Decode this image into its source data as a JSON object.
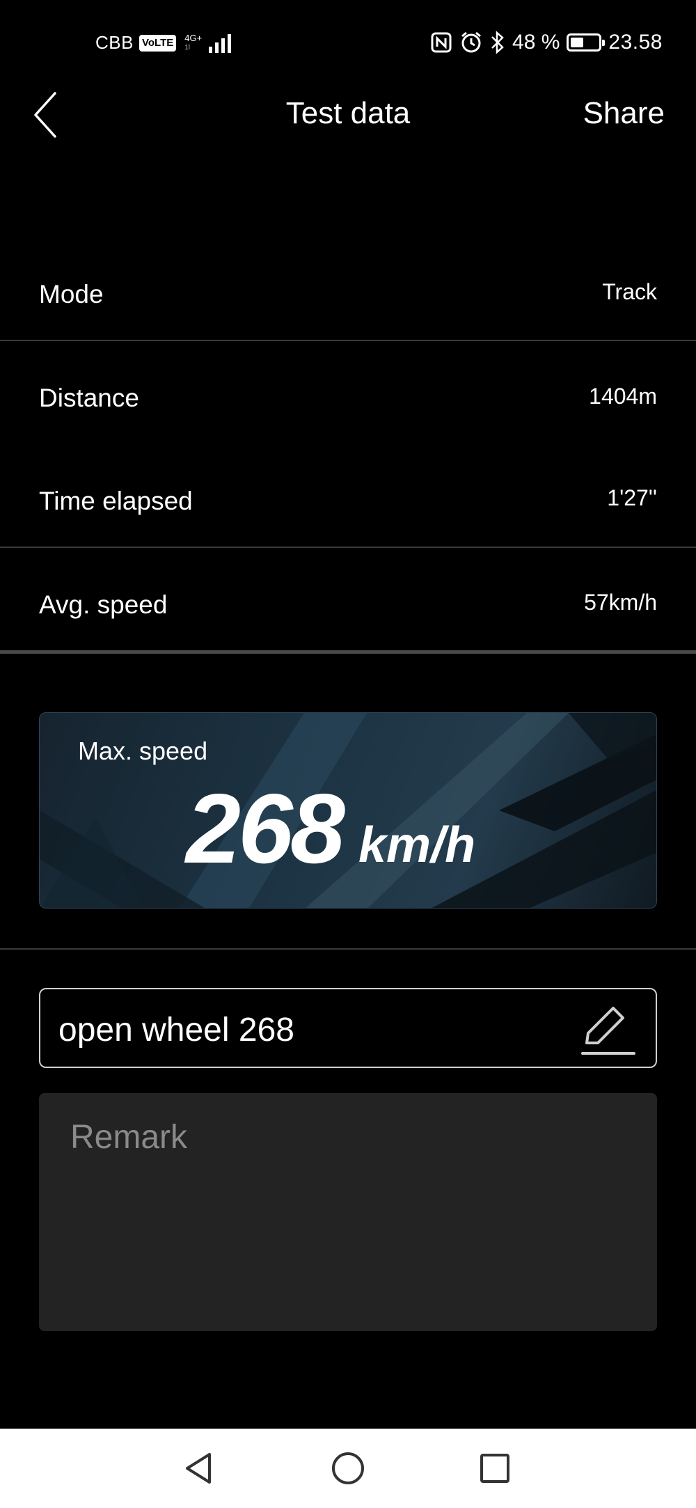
{
  "status_bar": {
    "carrier": "CBB",
    "volte": "VoLTE",
    "network": "4G+",
    "network_sub": "1l",
    "battery_percent": "48 %",
    "battery_level": 0.48,
    "time": "23.58",
    "icons": [
      "nfc-icon",
      "alarm-icon",
      "bluetooth-icon",
      "battery-icon"
    ]
  },
  "header": {
    "title": "Test data",
    "share_label": "Share"
  },
  "stats": [
    {
      "label": "Mode",
      "value": "Track"
    },
    {
      "label": "Distance",
      "value": "1404m"
    },
    {
      "label": "Time elapsed",
      "value": "1'27''"
    },
    {
      "label": "Avg. speed",
      "value": "57km/h"
    }
  ],
  "max_speed": {
    "label": "Max. speed",
    "value": "268",
    "unit": "km/h"
  },
  "name_field": {
    "value": "open wheel 268"
  },
  "remark": {
    "placeholder": "Remark"
  },
  "colors": {
    "background": "#000000",
    "divider": "#3a3a3a",
    "card": "#1d3444",
    "remark_bg": "#232323"
  }
}
